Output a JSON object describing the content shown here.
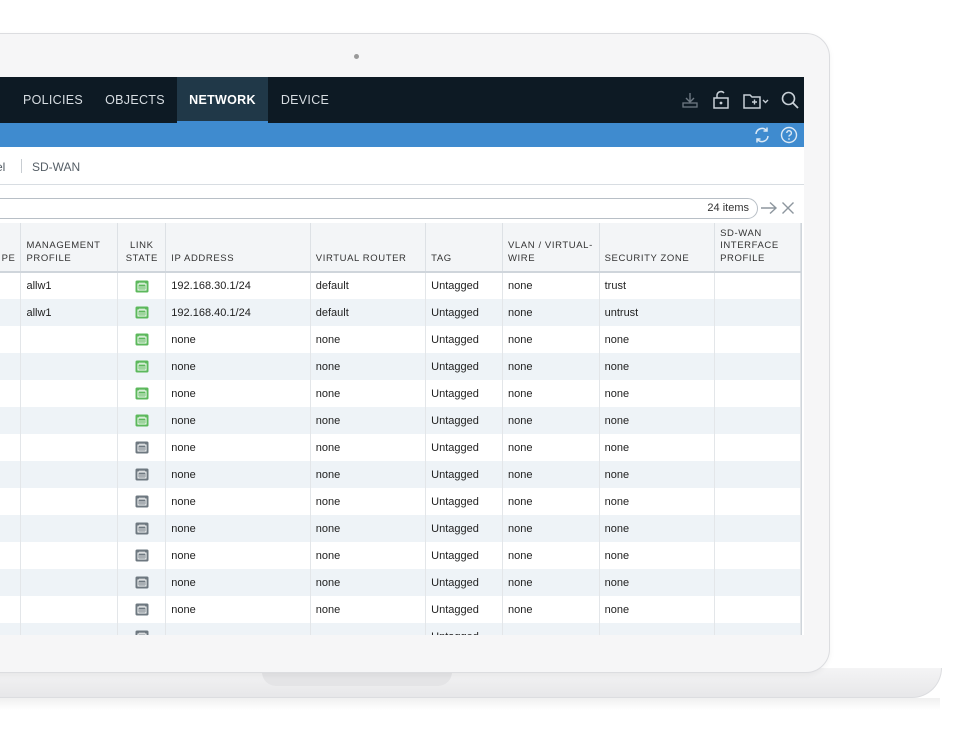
{
  "nav": {
    "tabs": [
      {
        "label": "POLICIES",
        "active": false
      },
      {
        "label": "OBJECTS",
        "active": false
      },
      {
        "label": "NETWORK",
        "active": true
      },
      {
        "label": "DEVICE",
        "active": false
      }
    ],
    "icons": [
      "commit-icon",
      "lock-icon",
      "config-icon",
      "search-icon"
    ]
  },
  "toolbar": {
    "icons": [
      "refresh-icon",
      "help-icon"
    ]
  },
  "breadcrumbs": [
    "el",
    "SD-WAN"
  ],
  "filter": {
    "value": "",
    "count_text": "24 items"
  },
  "table": {
    "columns": [
      "PE",
      "MANAGEMENT PROFILE",
      "LINK STATE",
      "IP ADDRESS",
      "VIRTUAL ROUTER",
      "TAG",
      "VLAN / VIRTUAL-WIRE",
      "SECURITY ZONE",
      "SD-WAN INTERFACE PROFILE"
    ],
    "rows": [
      {
        "mgmt": "allw1",
        "link": "up",
        "ip": "192.168.30.1/24",
        "vr": "default",
        "tag": "Untagged",
        "vlan": "none",
        "zone": "trust",
        "sdwan": ""
      },
      {
        "mgmt": "allw1",
        "link": "up",
        "ip": "192.168.40.1/24",
        "vr": "default",
        "tag": "Untagged",
        "vlan": "none",
        "zone": "untrust",
        "sdwan": ""
      },
      {
        "mgmt": "",
        "link": "up",
        "ip": "none",
        "vr": "none",
        "tag": "Untagged",
        "vlan": "none",
        "zone": "none",
        "sdwan": ""
      },
      {
        "mgmt": "",
        "link": "up",
        "ip": "none",
        "vr": "none",
        "tag": "Untagged",
        "vlan": "none",
        "zone": "none",
        "sdwan": ""
      },
      {
        "mgmt": "",
        "link": "up",
        "ip": "none",
        "vr": "none",
        "tag": "Untagged",
        "vlan": "none",
        "zone": "none",
        "sdwan": ""
      },
      {
        "mgmt": "",
        "link": "up",
        "ip": "none",
        "vr": "none",
        "tag": "Untagged",
        "vlan": "none",
        "zone": "none",
        "sdwan": ""
      },
      {
        "mgmt": "",
        "link": "down",
        "ip": "none",
        "vr": "none",
        "tag": "Untagged",
        "vlan": "none",
        "zone": "none",
        "sdwan": ""
      },
      {
        "mgmt": "",
        "link": "down",
        "ip": "none",
        "vr": "none",
        "tag": "Untagged",
        "vlan": "none",
        "zone": "none",
        "sdwan": ""
      },
      {
        "mgmt": "",
        "link": "down",
        "ip": "none",
        "vr": "none",
        "tag": "Untagged",
        "vlan": "none",
        "zone": "none",
        "sdwan": ""
      },
      {
        "mgmt": "",
        "link": "down",
        "ip": "none",
        "vr": "none",
        "tag": "Untagged",
        "vlan": "none",
        "zone": "none",
        "sdwan": ""
      },
      {
        "mgmt": "",
        "link": "down",
        "ip": "none",
        "vr": "none",
        "tag": "Untagged",
        "vlan": "none",
        "zone": "none",
        "sdwan": ""
      },
      {
        "mgmt": "",
        "link": "down",
        "ip": "none",
        "vr": "none",
        "tag": "Untagged",
        "vlan": "none",
        "zone": "none",
        "sdwan": ""
      },
      {
        "mgmt": "",
        "link": "down",
        "ip": "none",
        "vr": "none",
        "tag": "Untagged",
        "vlan": "none",
        "zone": "none",
        "sdwan": ""
      },
      {
        "mgmt": "",
        "link": "down",
        "ip": "",
        "vr": "",
        "tag": "Untagged",
        "vlan": "",
        "zone": "",
        "sdwan": ""
      }
    ]
  },
  "colors": {
    "nav_bg": "#0d1a24",
    "nav_active": "#203848",
    "accent_bar": "#3f8bcf",
    "link_up": "#5cb85c",
    "link_down": "#6e7880"
  }
}
